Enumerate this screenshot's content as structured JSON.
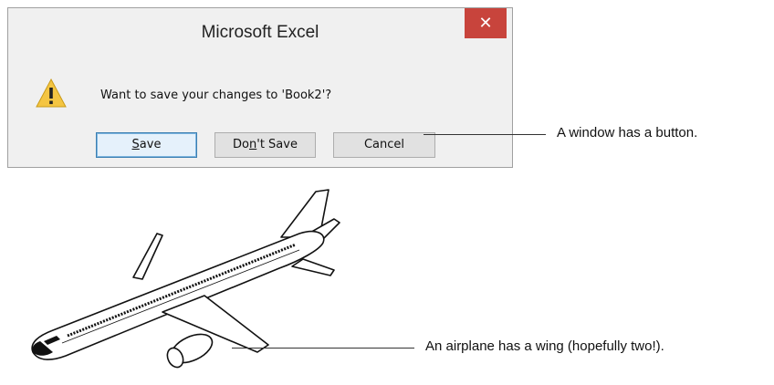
{
  "dialog": {
    "title": "Microsoft Excel",
    "message": "Want to save your changes to 'Book2'?",
    "close_glyph": "✕",
    "buttons": {
      "save_prefix": "",
      "save_mnemonic": "S",
      "save_suffix": "ave",
      "dontsave_prefix": "Do",
      "dontsave_mnemonic": "n",
      "dontsave_suffix": "'t Save",
      "cancel_label": "Cancel"
    },
    "icon": "warning-icon"
  },
  "annotations": {
    "button_note": "A window has a button.",
    "wing_note": "An airplane has a wing (hopefully two!)."
  },
  "colors": {
    "close_button": "#c8443c",
    "dialog_bg": "#f0f0f0",
    "warning_yellow": "#f4c542",
    "primary_border": "#3c7fb1"
  }
}
